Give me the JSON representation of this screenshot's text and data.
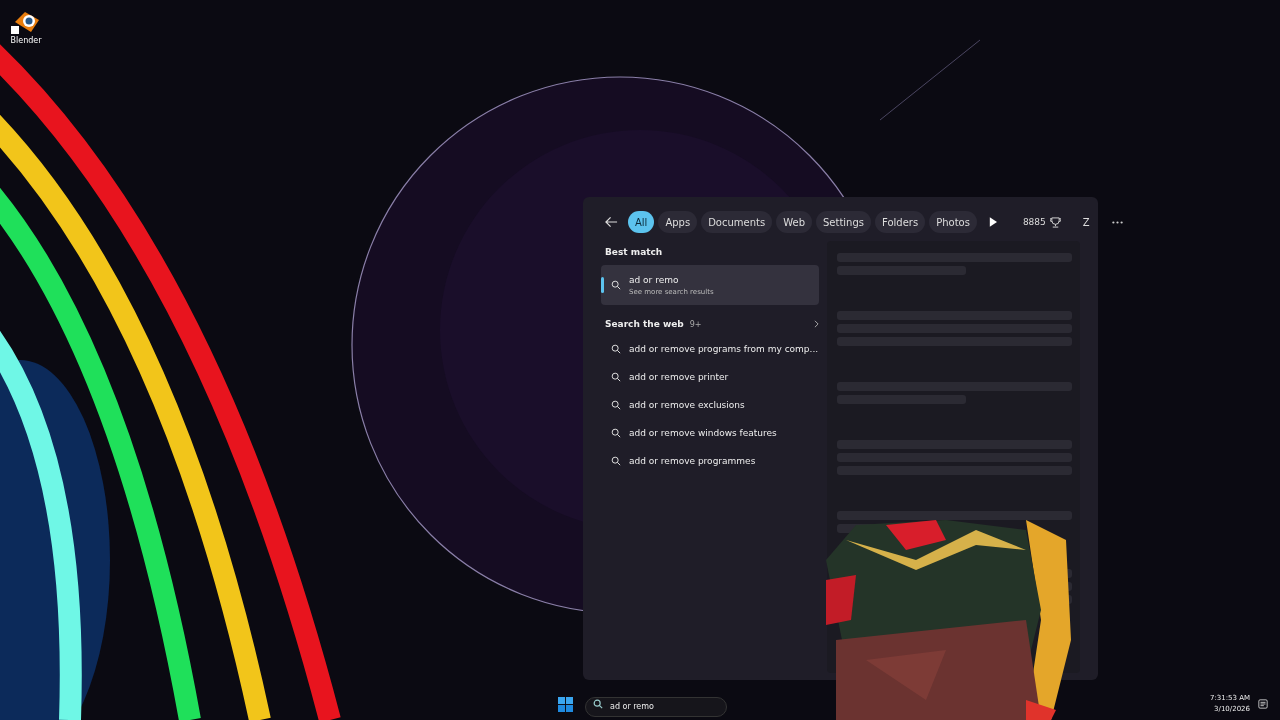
{
  "desktop": {
    "icons": [
      {
        "label": "Blender"
      }
    ]
  },
  "search_panel": {
    "filters": [
      {
        "label": "All",
        "selected": true
      },
      {
        "label": "Apps",
        "selected": false
      },
      {
        "label": "Documents",
        "selected": false
      },
      {
        "label": "Web",
        "selected": false
      },
      {
        "label": "Settings",
        "selected": false
      },
      {
        "label": "Folders",
        "selected": false
      },
      {
        "label": "Photos",
        "selected": false
      }
    ],
    "points": "8885",
    "account_initial": "Z",
    "best_match": {
      "heading": "Best match",
      "title": "ad or remo",
      "subtitle": "See more search results"
    },
    "web": {
      "heading": "Search the web",
      "count": "9+",
      "results": [
        "add or remove programs from my comp...",
        "add or remove printer",
        "add or remove exclusions",
        "add or remove windows features",
        "add or remove programmes"
      ]
    }
  },
  "taskbar": {
    "search_value": "ad or remo",
    "time": "7:31:53 AM",
    "date": "3/10/2026"
  }
}
